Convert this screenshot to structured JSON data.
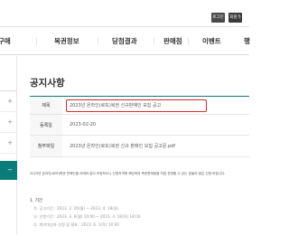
{
  "topbar": {
    "btn1": "로그인",
    "btn2": "회원가입"
  },
  "gnb": {
    "items": [
      "구매",
      "복권정보",
      "당첨결과",
      "판매점",
      "이벤트",
      "행"
    ]
  },
  "leftmenu": {
    "items": [
      "+",
      "+",
      "+",
      "+",
      "−"
    ]
  },
  "page": {
    "title": "공지사항"
  },
  "notice": {
    "subject_label": "제목",
    "subject": "2023년 온라인(로또)복권 신규판매인 모집 공고",
    "date_label": "등록일",
    "date": "2023-02-20",
    "attach_label": "첨부파일",
    "attach": "2023년 온라인(로또)복권 신규 판매인 모집 공고문.pdf"
  },
  "body": {
    "line1": "2023년 온라인(로또)복권 판매인을 아래와 같이 모집하오니 신청자격에 해당하여 복권판매점을 직접 운영할 수 있는 분들의 많은 신청 바랍니다.",
    "section": "1. 기간",
    "items": [
      "가. 공고기간 : 2023. 2. 20(월) ~ 2023. 4. 18(화)",
      "나. 신청기간 : 2023. 3. 6(월) 10:00 ~ 2023. 4. 18(화) 18:00",
      "다. 계약대상자 선정 및 발표 : 2023. 6. 1(목) 10:00"
    ]
  }
}
